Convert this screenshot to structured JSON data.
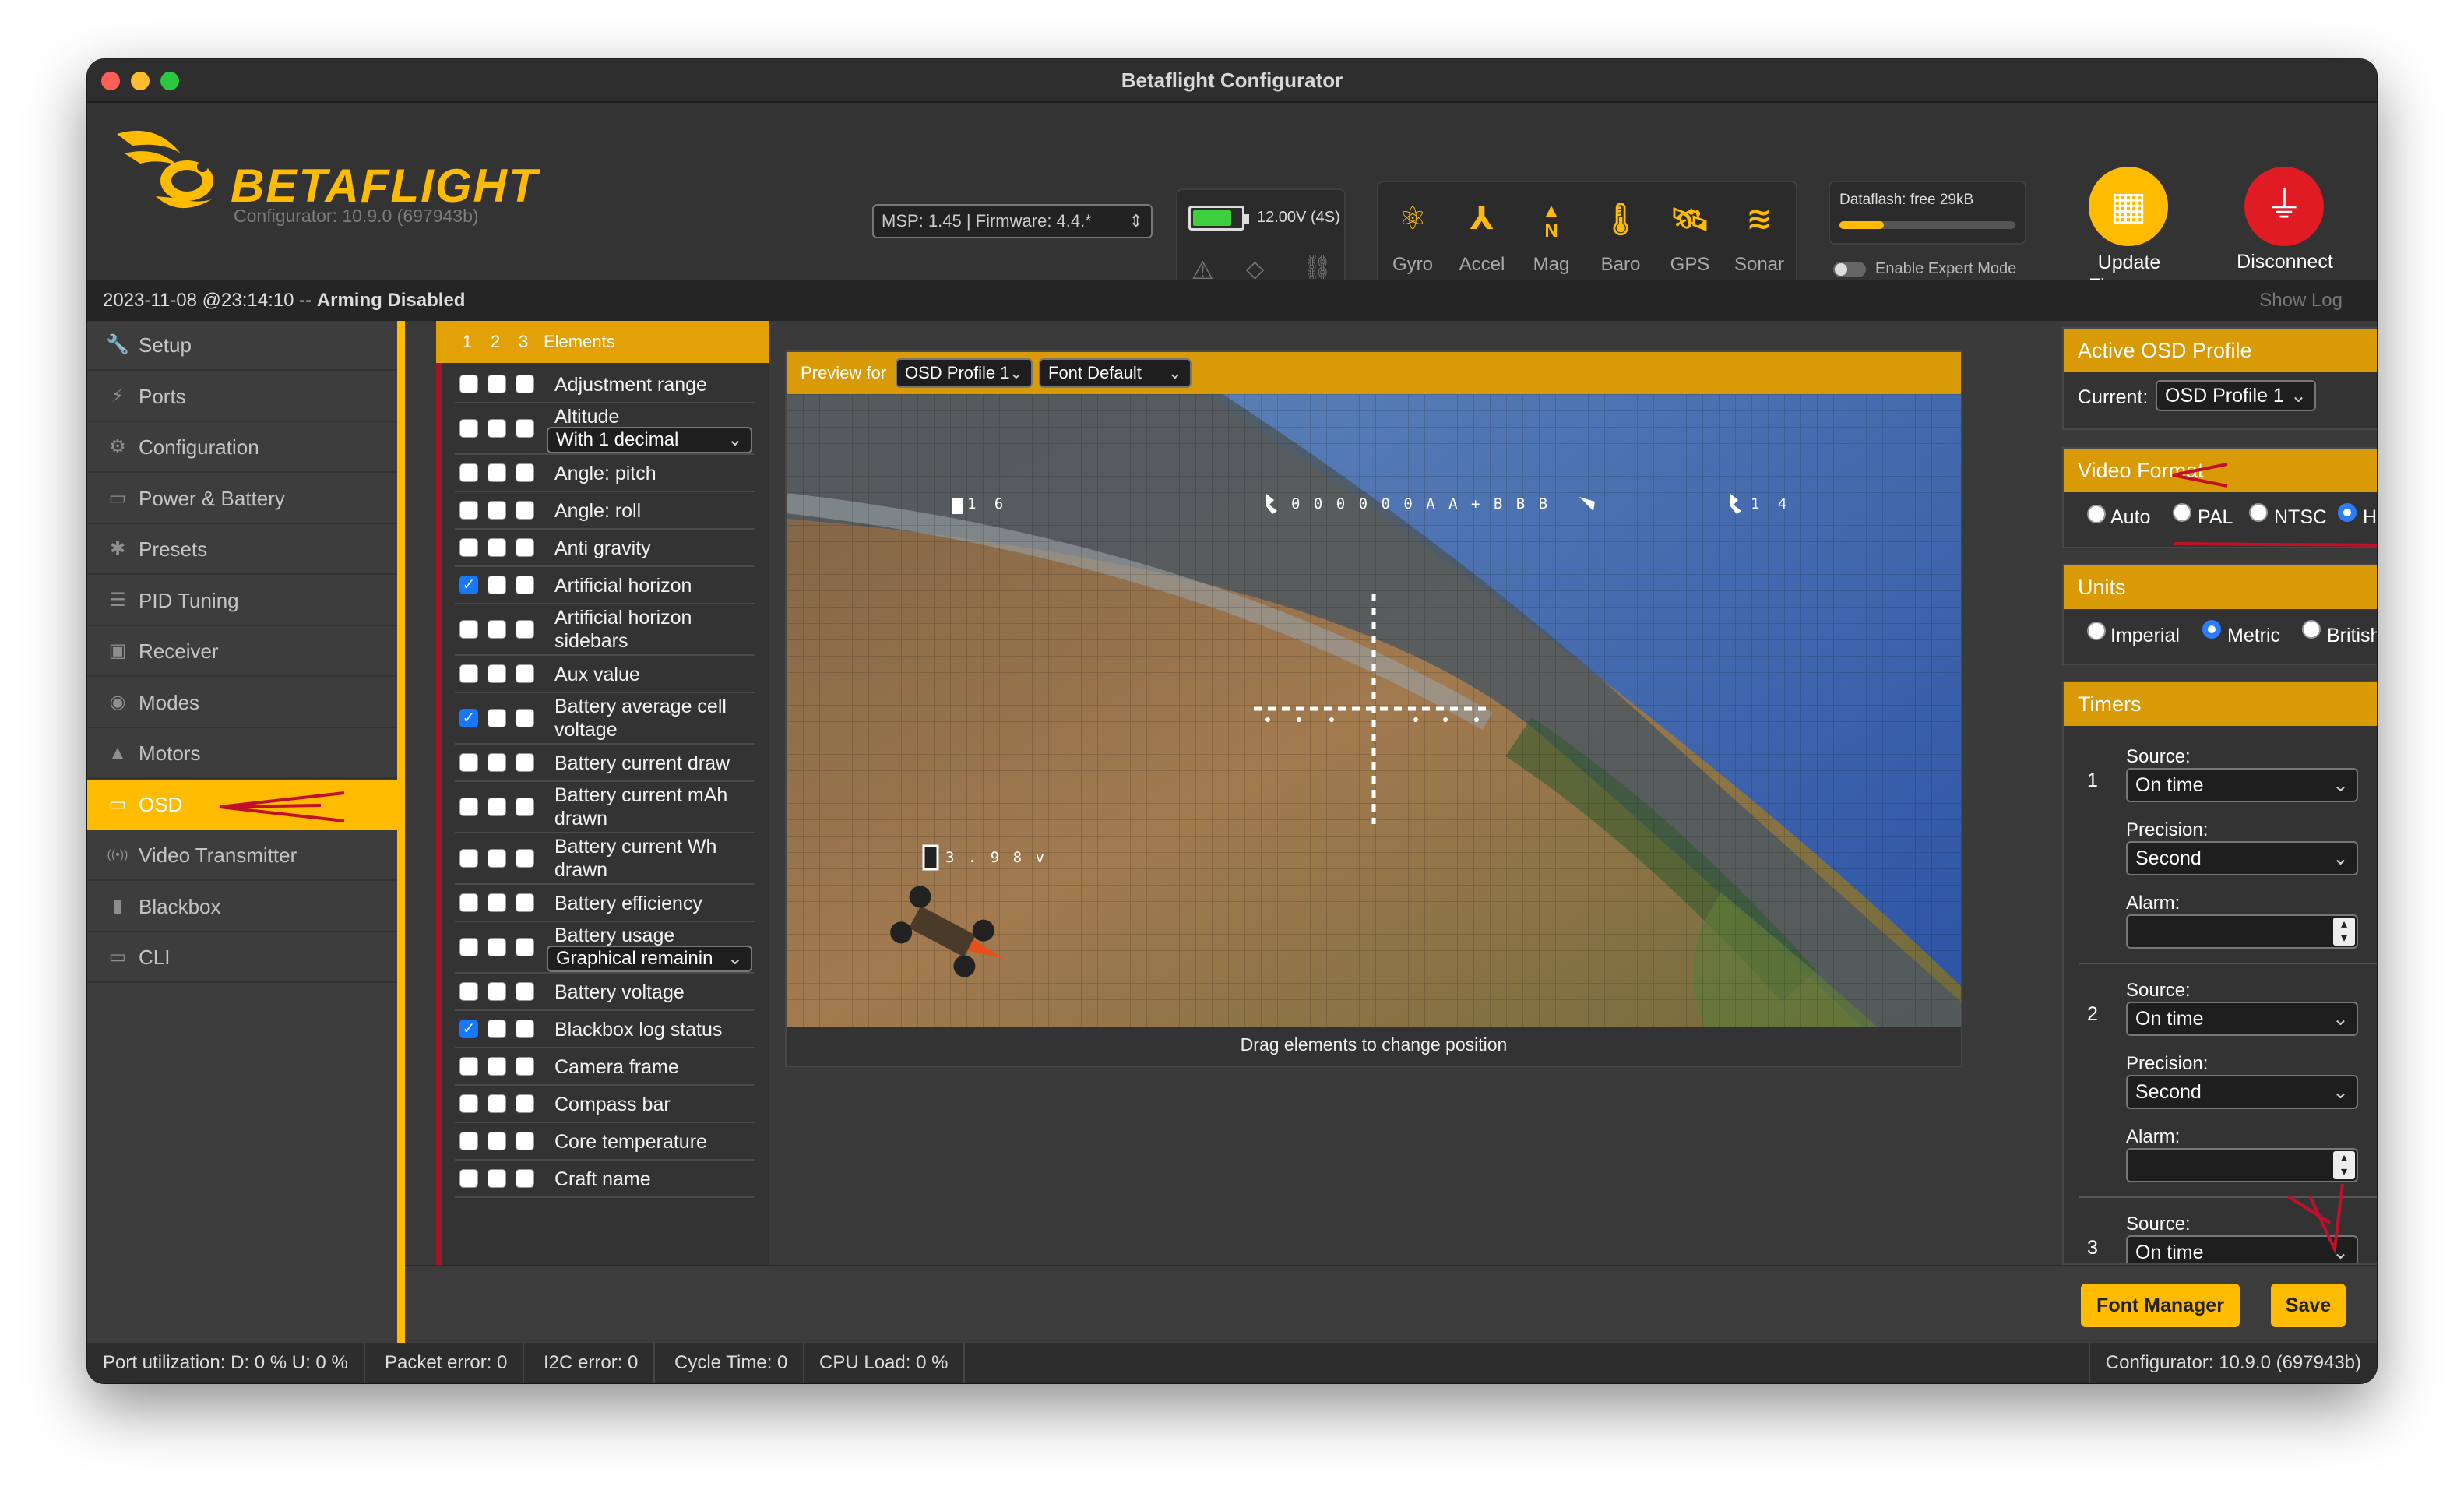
{
  "window": {
    "title": "Betaflight Configurator"
  },
  "header": {
    "logo_text": "BETAFLIGHT",
    "configurator_version": "Configurator: 10.9.0 (697943b)",
    "msp_firmware": "MSP: 1.45 | Firmware: 4.4.*",
    "battery_voltage": "12.00V (4S)",
    "battery_level": 0.85,
    "sensors": [
      {
        "label": "Gyro",
        "icon": "gyro-icon"
      },
      {
        "label": "Accel",
        "icon": "accel-icon"
      },
      {
        "label": "Mag",
        "icon": "mag-icon",
        "glyph": "N"
      },
      {
        "label": "Baro",
        "icon": "baro-icon"
      },
      {
        "label": "GPS",
        "icon": "gps-icon"
      },
      {
        "label": "Sonar",
        "icon": "sonar-icon"
      }
    ],
    "dataflash_label": "Dataflash: free 29kB",
    "dataflash_used": 0.25,
    "expert_mode_label": "Enable Expert Mode",
    "update_firmware_label": "Update\nFirmware",
    "disconnect_label": "Disconnect"
  },
  "status": {
    "datetime": "2023-11-08 @23:14:10 --",
    "arming": "Arming Disabled",
    "show_log": "Show Log"
  },
  "sidebar": {
    "items": [
      {
        "label": "Setup",
        "icon": "wrench-icon",
        "glyph": "🔧"
      },
      {
        "label": "Ports",
        "icon": "plug-icon",
        "glyph": "⚡"
      },
      {
        "label": "Configuration",
        "icon": "gear-icon",
        "glyph": "⚙"
      },
      {
        "label": "Power & Battery",
        "icon": "battery-icon",
        "glyph": "▭"
      },
      {
        "label": "Presets",
        "icon": "presets-icon",
        "glyph": "✱"
      },
      {
        "label": "PID Tuning",
        "icon": "pid-icon",
        "glyph": "☰"
      },
      {
        "label": "Receiver",
        "icon": "receiver-icon",
        "glyph": "▣"
      },
      {
        "label": "Modes",
        "icon": "modes-icon",
        "glyph": "◉"
      },
      {
        "label": "Motors",
        "icon": "motor-icon",
        "glyph": "▲"
      },
      {
        "label": "OSD",
        "icon": "osd-icon",
        "glyph": "▭",
        "active": true
      },
      {
        "label": "Video Transmitter",
        "icon": "vtx-icon",
        "glyph": "((•))"
      },
      {
        "label": "Blackbox",
        "icon": "blackbox-icon",
        "glyph": "▮"
      },
      {
        "label": "CLI",
        "icon": "cli-icon",
        "glyph": "▭"
      }
    ]
  },
  "elements_panel": {
    "header_numbers": [
      "1",
      "2",
      "3"
    ],
    "header_label": "Elements",
    "rows": [
      {
        "label": "Adjustment range",
        "checks": [
          false,
          false,
          false
        ]
      },
      {
        "label": "Altitude",
        "checks": [
          false,
          false,
          false
        ],
        "select": "With 1 decimal"
      },
      {
        "label": "Angle: pitch",
        "checks": [
          false,
          false,
          false
        ]
      },
      {
        "label": "Angle: roll",
        "checks": [
          false,
          false,
          false
        ]
      },
      {
        "label": "Anti gravity",
        "checks": [
          false,
          false,
          false
        ]
      },
      {
        "label": "Artificial horizon",
        "checks": [
          true,
          false,
          false
        ]
      },
      {
        "label": "Artificial horizon\nsidebars",
        "checks": [
          false,
          false,
          false
        ]
      },
      {
        "label": "Aux value",
        "checks": [
          false,
          false,
          false
        ]
      },
      {
        "label": "Battery average cell\nvoltage",
        "checks": [
          true,
          false,
          false
        ]
      },
      {
        "label": "Battery current draw",
        "checks": [
          false,
          false,
          false
        ]
      },
      {
        "label": "Battery current mAh\ndrawn",
        "checks": [
          false,
          false,
          false
        ]
      },
      {
        "label": "Battery current Wh\ndrawn",
        "checks": [
          false,
          false,
          false
        ]
      },
      {
        "label": "Battery efficiency",
        "checks": [
          false,
          false,
          false
        ]
      },
      {
        "label": "Battery usage",
        "checks": [
          false,
          false,
          false
        ],
        "select": "Graphical remainin"
      },
      {
        "label": "Battery voltage",
        "checks": [
          false,
          false,
          false
        ]
      },
      {
        "label": "Blackbox log status",
        "checks": [
          true,
          false,
          false
        ]
      },
      {
        "label": "Camera frame",
        "checks": [
          false,
          false,
          false
        ]
      },
      {
        "label": "Compass bar",
        "checks": [
          false,
          false,
          false
        ]
      },
      {
        "label": "Core temperature",
        "checks": [
          false,
          false,
          false
        ]
      },
      {
        "label": "Craft name",
        "checks": [
          false,
          false,
          false
        ]
      }
    ]
  },
  "preview": {
    "preview_for_label": "Preview for",
    "profile_select": "OSD Profile 1",
    "font_select": "Font Default",
    "caption": "Drag elements to change position",
    "osd_top_left": "1 6",
    "osd_top_mid": "0 0 0 0 0 0 A A + B B B",
    "osd_top_right": "1 4",
    "osd_voltage": "3 . 9 8 v"
  },
  "right_panel": {
    "active_profile": {
      "title": "Active OSD Profile",
      "current_label": "Current:",
      "current_value": "OSD Profile 1"
    },
    "video_format": {
      "title": "Video Format",
      "options": [
        "Auto",
        "PAL",
        "NTSC",
        "HD"
      ],
      "selected": "HD"
    },
    "units": {
      "title": "Units",
      "options": [
        "Imperial",
        "Metric",
        "British"
      ],
      "selected": "Metric"
    },
    "timers": {
      "title": "Timers",
      "source_label": "Source:",
      "precision_label": "Precision:",
      "alarm_label": "Alarm:",
      "items": [
        {
          "number": "1",
          "source": "On time",
          "precision": "Second"
        },
        {
          "number": "2",
          "source": "On time",
          "precision": "Second"
        },
        {
          "number": "3",
          "source": "On time"
        }
      ]
    }
  },
  "bottom": {
    "font_manager_label": "Font Manager",
    "save_label": "Save"
  },
  "footer": {
    "port_util": "Port utilization: D: 0 % U: 0 %",
    "packet_error": "Packet error: 0",
    "i2c_error": "I2C error: 0",
    "cycle_time": "Cycle Time: 0",
    "cpu_load": "CPU Load: 0 %",
    "configurator_version": "Configurator: 10.9.0 (697943b)"
  },
  "colors": {
    "accent": "#ffbb00",
    "header_gold": "#d99a07",
    "annotation": "#c0102a"
  }
}
